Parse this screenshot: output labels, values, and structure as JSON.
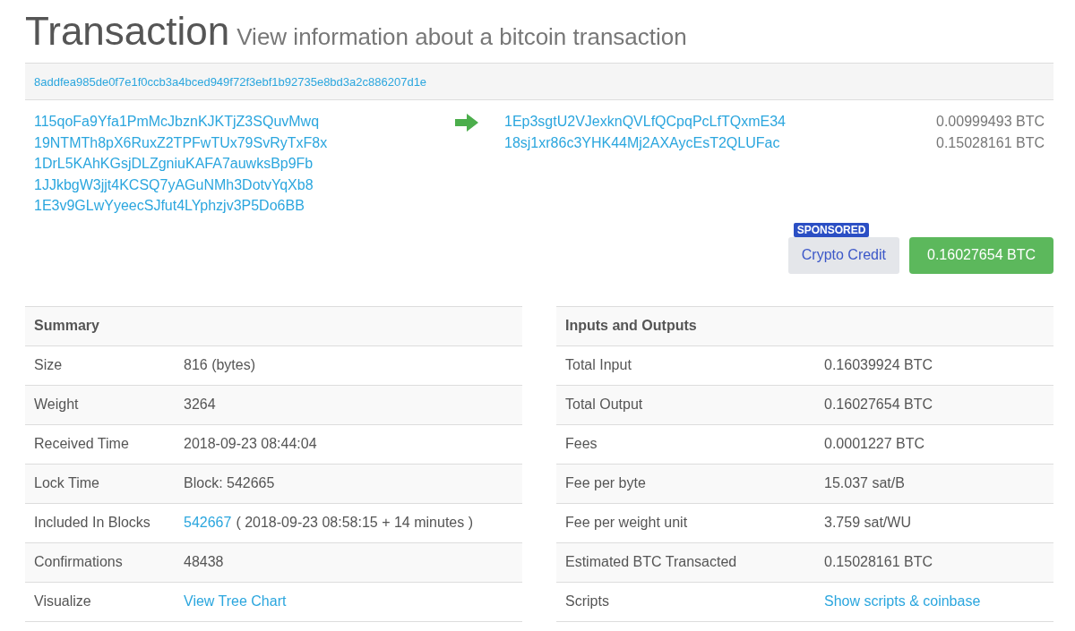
{
  "header": {
    "title": "Transaction",
    "subtitle": "View information about a bitcoin transaction"
  },
  "hash": "8addfea985de0f7e1f0ccb3a4bced949f72f3ebf1b92735e8bd3a2c886207d1e",
  "inputs": [
    "115qoFa9Yfa1PmMcJbznKJKTjZ3SQuvMwq",
    "19NTMTh8pX6RuxZ2TPFwTUx79SvRyTxF8x",
    "1DrL5KAhKGsjDLZgniuKAFA7auwksBp9Fb",
    "1JJkbgW3jjt4KCSQ7yAGuNMh3DotvYqXb8",
    "1E3v9GLwYyeecSJfut4LYphzjv3P5Do6BB"
  ],
  "outputs": [
    {
      "address": "1Ep3sgtU2VJexknQVLfQCpqPcLfTQxmE34",
      "amount": "0.00999493 BTC"
    },
    {
      "address": "18sj1xr86c3YHK44Mj2AXAycEsT2QLUFac",
      "amount": "0.15028161 BTC"
    }
  ],
  "sponsored": {
    "badge": "SPONSORED",
    "label": "Crypto Credit"
  },
  "total": "0.16027654 BTC",
  "tables": [
    {
      "title": "Summary",
      "rows": [
        {
          "label": "Size",
          "kind": "text",
          "value": "816 (bytes)"
        },
        {
          "label": "Weight",
          "kind": "text",
          "value": "3264"
        },
        {
          "label": "Received Time",
          "kind": "text",
          "value": "2018-09-23 08:44:04"
        },
        {
          "label": "Lock Time",
          "kind": "text",
          "value": "Block: 542665"
        },
        {
          "label": "Included In Blocks",
          "kind": "link_text",
          "link": "542667",
          "value": "( 2018-09-23 08:58:15 + 14 minutes )"
        },
        {
          "label": "Confirmations",
          "kind": "text",
          "value": "48438"
        },
        {
          "label": "Visualize",
          "kind": "link",
          "link": "View Tree Chart"
        }
      ]
    },
    {
      "title": "Inputs and Outputs",
      "rows": [
        {
          "label": "Total Input",
          "kind": "text",
          "value": "0.16039924 BTC"
        },
        {
          "label": "Total Output",
          "kind": "text",
          "value": "0.16027654 BTC"
        },
        {
          "label": "Fees",
          "kind": "text",
          "value": "0.0001227 BTC"
        },
        {
          "label": "Fee per byte",
          "kind": "text",
          "value": "15.037 sat/B"
        },
        {
          "label": "Fee per weight unit",
          "kind": "text",
          "value": "3.759 sat/WU"
        },
        {
          "label": "Estimated BTC Transacted",
          "kind": "text",
          "value": "0.15028161 BTC"
        },
        {
          "label": "Scripts",
          "kind": "link",
          "link": "Show scripts & coinbase"
        }
      ]
    }
  ]
}
